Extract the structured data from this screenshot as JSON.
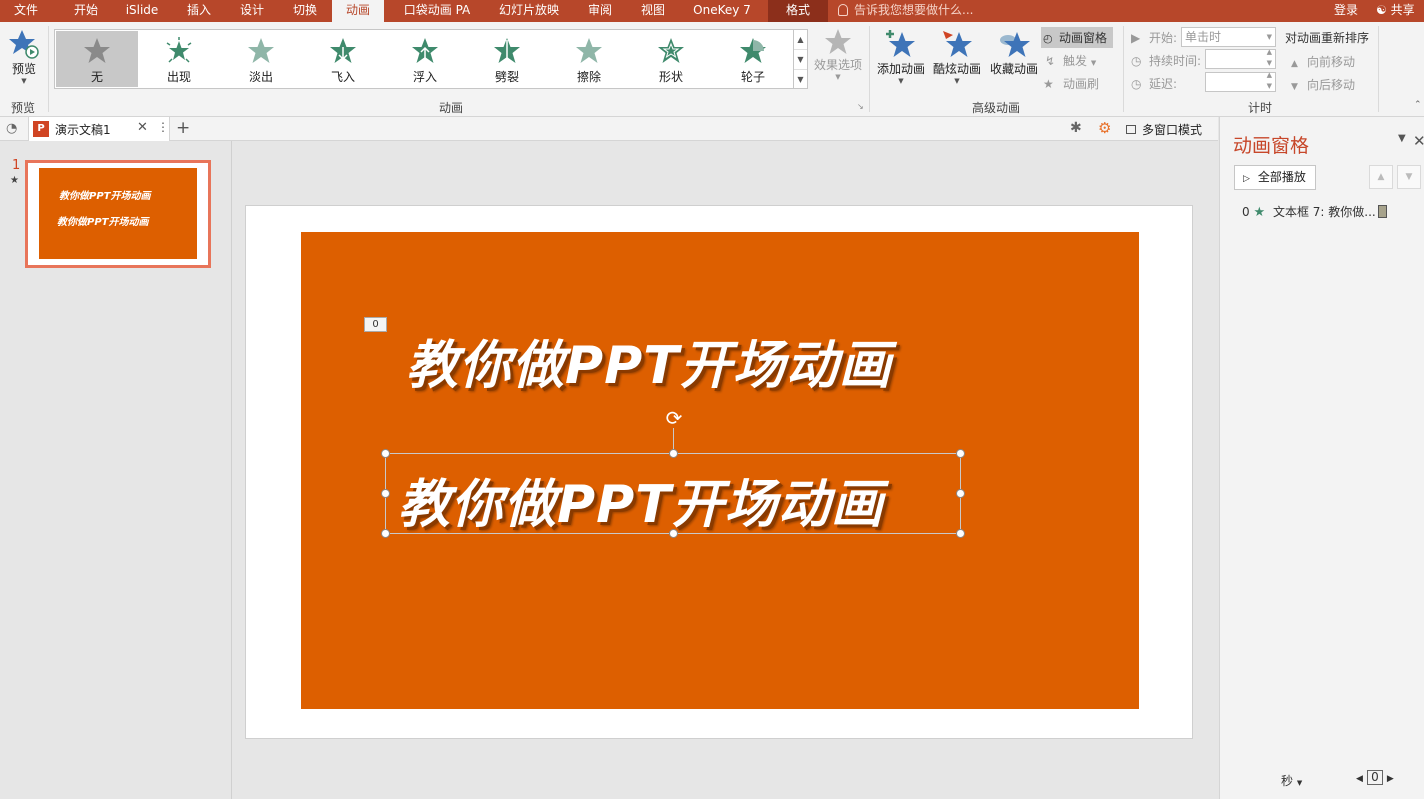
{
  "tabs": [
    {
      "label": "文件"
    },
    {
      "label": "开始"
    },
    {
      "label": "iSlide"
    },
    {
      "label": "插入"
    },
    {
      "label": "设计"
    },
    {
      "label": "切换"
    },
    {
      "label": "动画"
    },
    {
      "label": "口袋动画 PA"
    },
    {
      "label": "幻灯片放映"
    },
    {
      "label": "审阅"
    },
    {
      "label": "视图"
    },
    {
      "label": "OneKey 7"
    },
    {
      "label": "格式"
    }
  ],
  "tell_me": "告诉我您想要做什么...",
  "login": "登录",
  "share": "共享",
  "ribbon": {
    "preview_button": "预览",
    "preview_group": "预览",
    "animation_gallery": [
      {
        "label": "无",
        "icon": "star-none-icon",
        "color": "#8a8a8a"
      },
      {
        "label": "出现",
        "icon": "star-appear-icon",
        "color": "#3f8a6c"
      },
      {
        "label": "淡出",
        "icon": "star-fade-icon",
        "color": "#8fb6a8"
      },
      {
        "label": "飞入",
        "icon": "star-fly-in-icon",
        "color": "#3f8a6c"
      },
      {
        "label": "浮入",
        "icon": "star-float-in-icon",
        "color": "#3f8a6c"
      },
      {
        "label": "劈裂",
        "icon": "star-split-icon",
        "color": "#3f8a6c"
      },
      {
        "label": "擦除",
        "icon": "star-wipe-icon",
        "color": "#8fb6a8"
      },
      {
        "label": "形状",
        "icon": "star-shape-icon",
        "color": "#3f8a6c"
      },
      {
        "label": "轮子",
        "icon": "star-wheel-icon",
        "color": "#3f8a6c"
      }
    ],
    "effect_options": "效果选项",
    "animation_group": "动画",
    "add_animation": "添加动画",
    "cool_animation": "酷炫动画",
    "collect_animation": "收藏动画",
    "animation_pane_button": "动画窗格",
    "trigger": "触发",
    "animation_painter": "动画刷",
    "advanced_group": "高级动画",
    "start_label": "开始:",
    "start_value": "单击时",
    "duration_label": "持续时间:",
    "delay_label": "延迟:",
    "timing_group": "计时",
    "reorder_title": "对动画重新排序",
    "move_earlier": "向前移动",
    "move_later": "向后移动"
  },
  "document": {
    "tab_title": "演示文稿1",
    "multi_window": "多窗口模式"
  },
  "thumbnails": [
    {
      "number": "1",
      "line1": "教你做PPT开场动画",
      "line2": "教你做PPT开场动画"
    }
  ],
  "slide": {
    "title_text": "教你做PPT开场动画",
    "sub_text": "教你做PPT开场动画",
    "animation_marker": "0",
    "background": "#dd5f00"
  },
  "animation_pane": {
    "title": "动画窗格",
    "play_all": "全部播放",
    "items": [
      {
        "index": "0",
        "label": "文本框 7: 教你做..."
      }
    ],
    "seconds": "秒",
    "zoom_value": "0"
  }
}
